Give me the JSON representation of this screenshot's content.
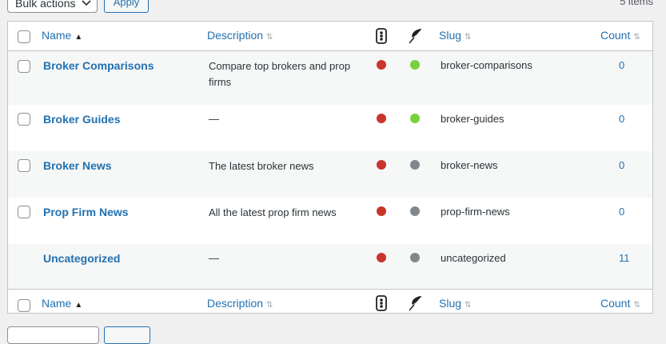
{
  "tablenav": {
    "bulk_actions_label": "Bulk actions",
    "apply_label": "Apply",
    "items_count": "5 items"
  },
  "columns": {
    "name": "Name",
    "description": "Description",
    "slug": "Slug",
    "count": "Count",
    "status_icon": "traffic-light-icon",
    "seo_icon": "feather-icon"
  },
  "colors": {
    "red": "#c9352b",
    "green": "#7ad03a",
    "gray": "#82878c",
    "link": "#2271b1"
  },
  "rows": [
    {
      "name": "Broker Comparisons",
      "description": "Compare top brokers and prop firms",
      "status": "red",
      "seo": "green",
      "slug": "broker-comparisons",
      "count": "0",
      "has_checkbox": true
    },
    {
      "name": "Broker Guides",
      "description": "—",
      "status": "red",
      "seo": "green",
      "slug": "broker-guides",
      "count": "0",
      "has_checkbox": true
    },
    {
      "name": "Broker News",
      "description": "The latest broker news",
      "status": "red",
      "seo": "gray",
      "slug": "broker-news",
      "count": "0",
      "has_checkbox": true
    },
    {
      "name": "Prop Firm News",
      "description": "All the latest prop firm news",
      "status": "red",
      "seo": "gray",
      "slug": "prop-firm-news",
      "count": "0",
      "has_checkbox": true
    },
    {
      "name": "Uncategorized",
      "description": "—",
      "status": "red",
      "seo": "gray",
      "slug": "uncategorized",
      "count": "11",
      "has_checkbox": false
    }
  ]
}
